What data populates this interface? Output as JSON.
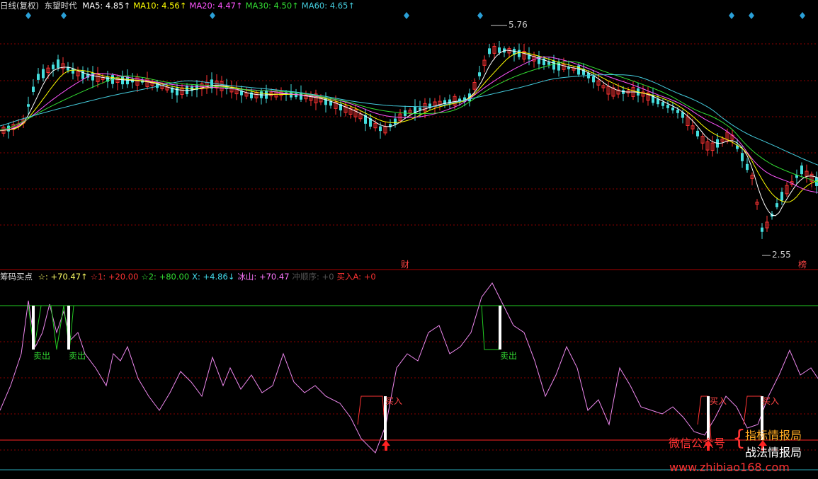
{
  "header": {
    "period": "日线(复权)",
    "stock_name": "东望时代",
    "ma": [
      {
        "label": "MA5: 4.85",
        "arrow": "↑",
        "color": "#ffffff"
      },
      {
        "label": "MA10: 4.56",
        "arrow": "↑",
        "color": "#ffff00"
      },
      {
        "label": "MA20: 4.47",
        "arrow": "↑",
        "color": "#ff55ff"
      },
      {
        "label": "MA30: 4.50",
        "arrow": "↑",
        "color": "#33dd33"
      },
      {
        "label": "MA60: 4.65",
        "arrow": "↑",
        "color": "#44ccdd"
      }
    ]
  },
  "price_panel": {
    "high_label": "5.76",
    "low_label": "2.55",
    "event_cai": "财",
    "event_bang": "榜"
  },
  "indicator_header": {
    "name": "筹码买点",
    "items": [
      {
        "label": "☆: +70.47",
        "arrow": "↑",
        "color": "#ffff66"
      },
      {
        "label": "☆1: +20.00",
        "arrow": "",
        "color": "#ff3333"
      },
      {
        "label": "☆2: +80.00",
        "arrow": "",
        "color": "#33dd33"
      },
      {
        "label": "X: +4.86",
        "arrow": "↓",
        "color": "#44ddee"
      },
      {
        "label": "冰山: +70.47",
        "arrow": "",
        "color": "#ff77ff"
      },
      {
        "label": "冲顺序: +0",
        "arrow": "",
        "color": "#555555"
      },
      {
        "label": "买入A: +0",
        "arrow": "",
        "color": "#ff3333"
      }
    ]
  },
  "signals": {
    "sell": "卖出",
    "buy": "买入"
  },
  "promo": {
    "wechat": "微信公众号",
    "brace": "{",
    "line1": "指标情报局",
    "line2": "战法情报局",
    "url": "www.zhibiao168.com"
  },
  "colors": {
    "up": "#ff3333",
    "down": "#44dddd",
    "grid": "#8b0000",
    "indicator": "#ee88ee",
    "level_high": "#22cc22",
    "level_low": "#ff2222",
    "marker": "#2a9fd6"
  }
}
